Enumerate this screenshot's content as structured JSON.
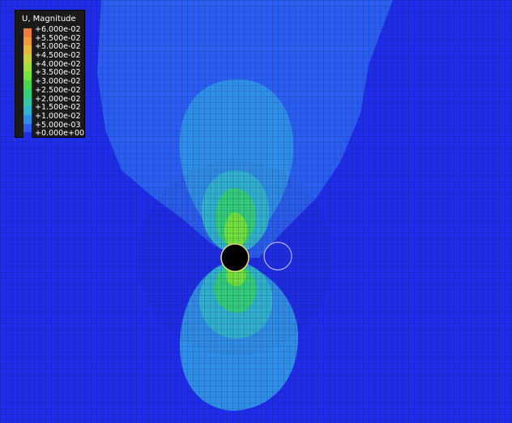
{
  "legend": {
    "title": "U, Magnitude",
    "entries": [
      {
        "label": "+6.000e-02",
        "color": "#f07a3a"
      },
      {
        "label": "+5.500e-02",
        "color": "#f29a3a"
      },
      {
        "label": "+5.000e-02",
        "color": "#e5b83a"
      },
      {
        "label": "+4.500e-02",
        "color": "#c9d23a"
      },
      {
        "label": "+4.000e-02",
        "color": "#a2e03a"
      },
      {
        "label": "+3.500e-02",
        "color": "#72e43a"
      },
      {
        "label": "+3.000e-02",
        "color": "#46d84a"
      },
      {
        "label": "+2.500e-02",
        "color": "#33d07a"
      },
      {
        "label": "+2.000e-02",
        "color": "#30c8a6"
      },
      {
        "label": "+1.500e-02",
        "color": "#30b4d0"
      },
      {
        "label": "+1.000e-02",
        "color": "#2f8ee8"
      },
      {
        "label": "+5.000e-03",
        "color": "#2a5ef0"
      },
      {
        "label": "+0.000e+00",
        "color": "#1f2de8"
      }
    ]
  },
  "colors": {
    "background": "#1f2de8",
    "contour_band_1": "#2a5ef0",
    "contour_band_2": "#2f8ee8",
    "contour_band_3": "#30b4d0",
    "contour_band_4": "#33d07a",
    "contour_band_5": "#72e43a",
    "hole": "#000000"
  }
}
